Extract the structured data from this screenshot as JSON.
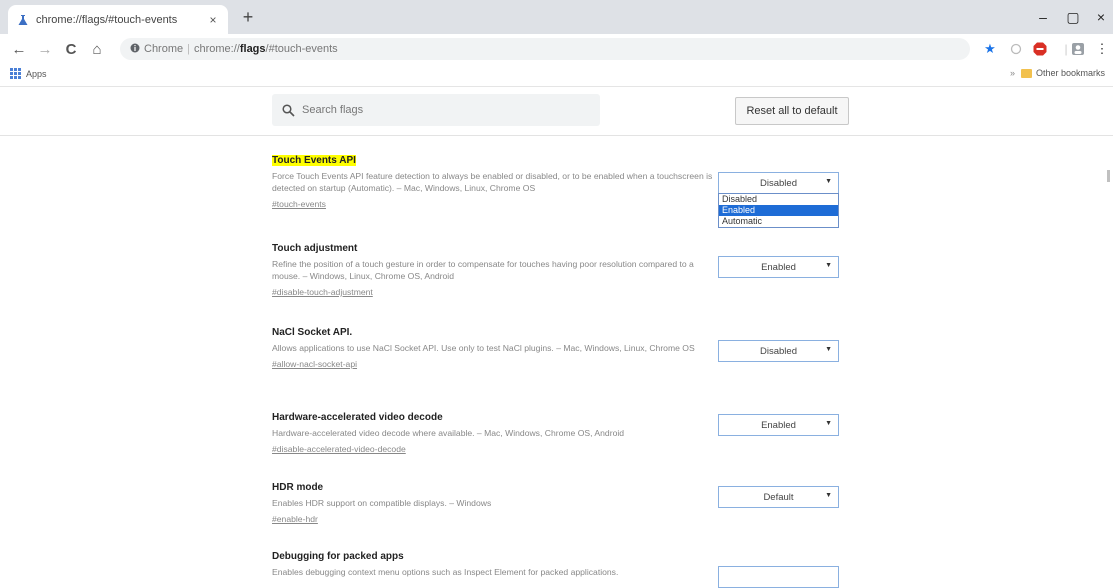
{
  "tab": {
    "title": "chrome://flags/#touch-events",
    "close": "×"
  },
  "newtab": "+",
  "window": {
    "minimize": "–",
    "maximize": "▢",
    "close": "×"
  },
  "nav": {
    "back": "←",
    "forward": "→",
    "reload": "C",
    "home": "⌂"
  },
  "omnibox": {
    "scheme": "Chrome",
    "sep": "|",
    "url_prefix": "chrome://",
    "url_host": "flags",
    "url_fragment": "/#touch-events"
  },
  "toolbar": {
    "star": "★",
    "menu": "⋮"
  },
  "bookmarks": {
    "apps": "Apps",
    "chevron": "»",
    "other": "Other bookmarks"
  },
  "search": {
    "placeholder": "Search flags"
  },
  "reset_label": "Reset all to default",
  "flags": [
    {
      "title": "Touch Events API",
      "desc": "Force Touch Events API feature detection to always be enabled or disabled, or to be enabled when a touchscreen is detected on startup (Automatic). – Mac, Windows, Linux, Chrome OS",
      "link": "#touch-events",
      "value": "Disabled"
    },
    {
      "title": "Touch adjustment",
      "desc": "Refine the position of a touch gesture in order to compensate for touches having poor resolution compared to a mouse. – Windows, Linux, Chrome OS, Android",
      "link": "#disable-touch-adjustment",
      "value": "Enabled"
    },
    {
      "title": "NaCl Socket API.",
      "desc": "Allows applications to use NaCl Socket API. Use only to test NaCl plugins. – Mac, Windows, Linux, Chrome OS",
      "link": "#allow-nacl-socket-api",
      "value": "Disabled"
    },
    {
      "title": "Hardware-accelerated video decode",
      "desc": "Hardware-accelerated video decode where available. – Mac, Windows, Chrome OS, Android",
      "link": "#disable-accelerated-video-decode",
      "value": "Enabled"
    },
    {
      "title": "HDR mode",
      "desc": "Enables HDR support on compatible displays. – Windows",
      "link": "#enable-hdr",
      "value": "Default"
    },
    {
      "title": "Debugging for packed apps",
      "desc": "Enables debugging context menu options such as Inspect Element for packed applications.",
      "link": "",
      "value": ""
    }
  ],
  "dropdown": {
    "options": [
      "Disabled",
      "Enabled",
      "Automatic"
    ],
    "highlighted": "Enabled"
  },
  "caret": "▼",
  "colors": {
    "highlight": "#ffff00",
    "selection": "#1e6cd6",
    "accent": "#1a73e8"
  }
}
